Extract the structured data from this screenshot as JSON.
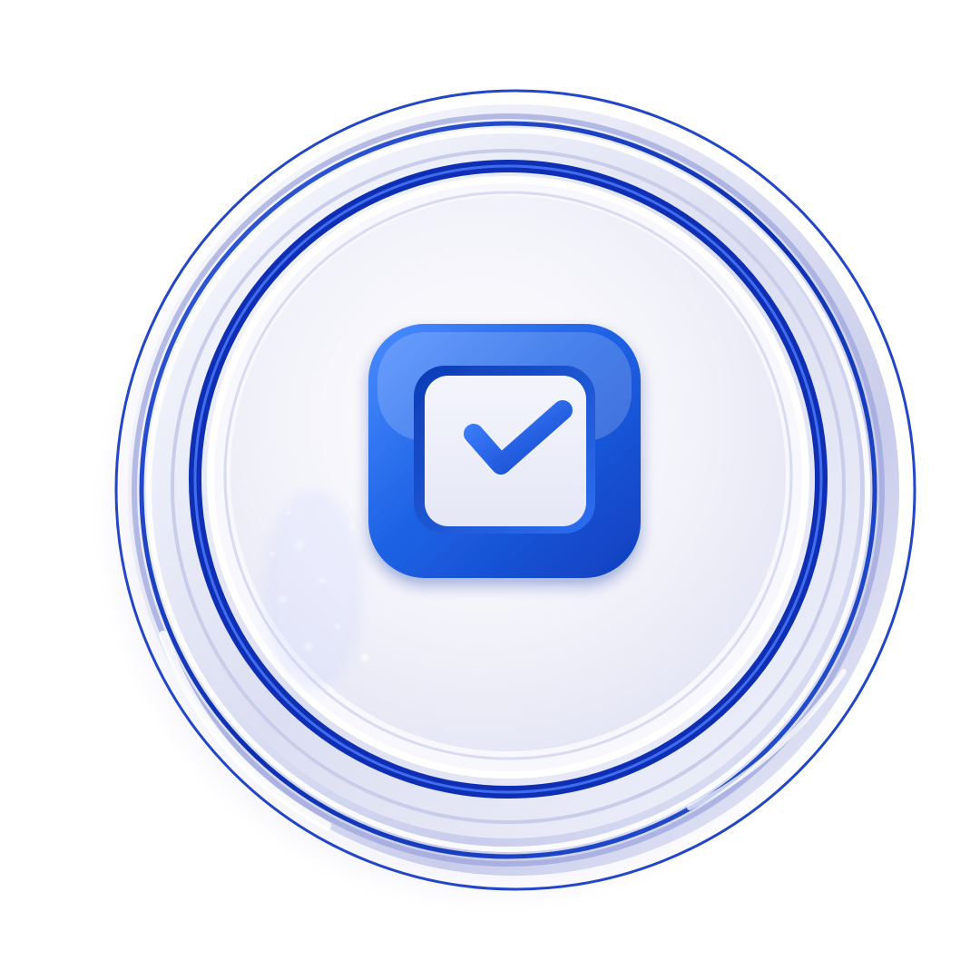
{
  "badge": {
    "icon": "checkbox-checked-icon",
    "state": "checked",
    "colors": {
      "background": "#ffffff",
      "accent_blue": "#1f63e6",
      "deep_blue": "#0b2fa8",
      "ring_silver": "#dfe2f2",
      "face_light": "#f3f3fb",
      "highlight": "#ffffff"
    }
  }
}
